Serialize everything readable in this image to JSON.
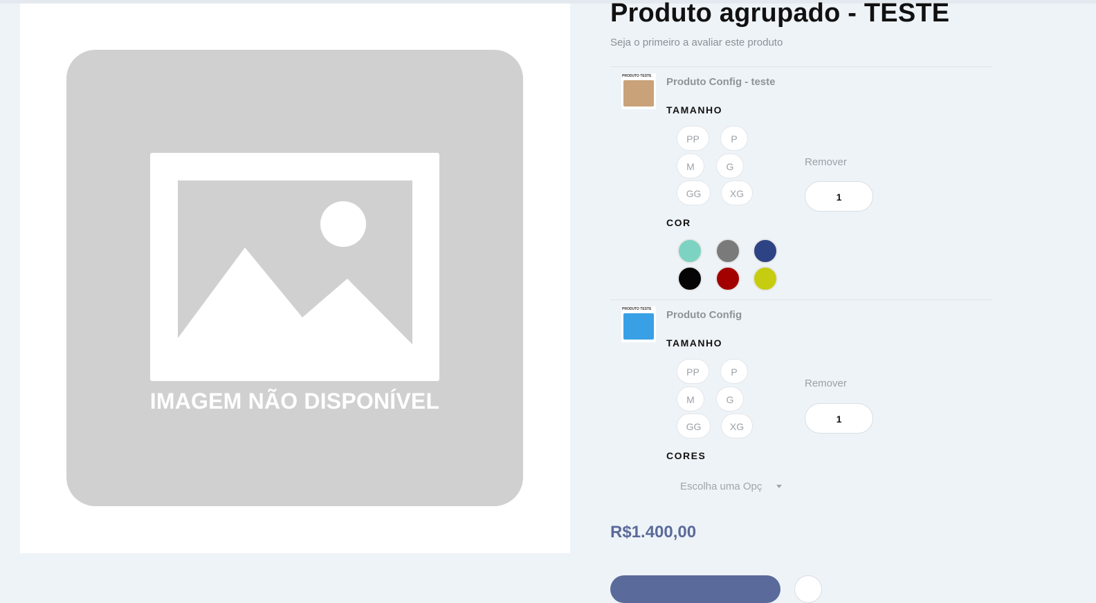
{
  "product": {
    "title": "Produto agrupado - TESTE",
    "review_prompt": "Seja o primeiro a avaliar este produto",
    "image_placeholder": "IMAGEM NÃO DISPONÍVEL",
    "price": "R$1.400,00"
  },
  "items": [
    {
      "thumb_caption": "PRODUTO TESTE",
      "thumb_color": "#c9a27a",
      "name": "Produto Config - teste",
      "size_label": "TAMANHO",
      "sizes": [
        "PP",
        "P",
        "M",
        "G",
        "GG",
        "XG"
      ],
      "color_label": "COR",
      "colors": [
        "#7dd3c1",
        "#7a7a7a",
        "#2e4383",
        "#050505",
        "#a30000",
        "#c6cc10"
      ],
      "remove": "Remover",
      "qty": "1"
    },
    {
      "thumb_caption": "PRODUTO TESTE",
      "thumb_color": "#3aa0e6",
      "name": "Produto Config",
      "size_label": "TAMANHO",
      "sizes": [
        "PP",
        "P",
        "M",
        "G",
        "GG",
        "XG"
      ],
      "color_label": "CORES",
      "select_placeholder": "Escolha uma Opção...",
      "remove": "Remover",
      "qty": "1"
    }
  ],
  "colors": {
    "accent": "#5a6a9a",
    "page_bg": "#eef3f8"
  }
}
